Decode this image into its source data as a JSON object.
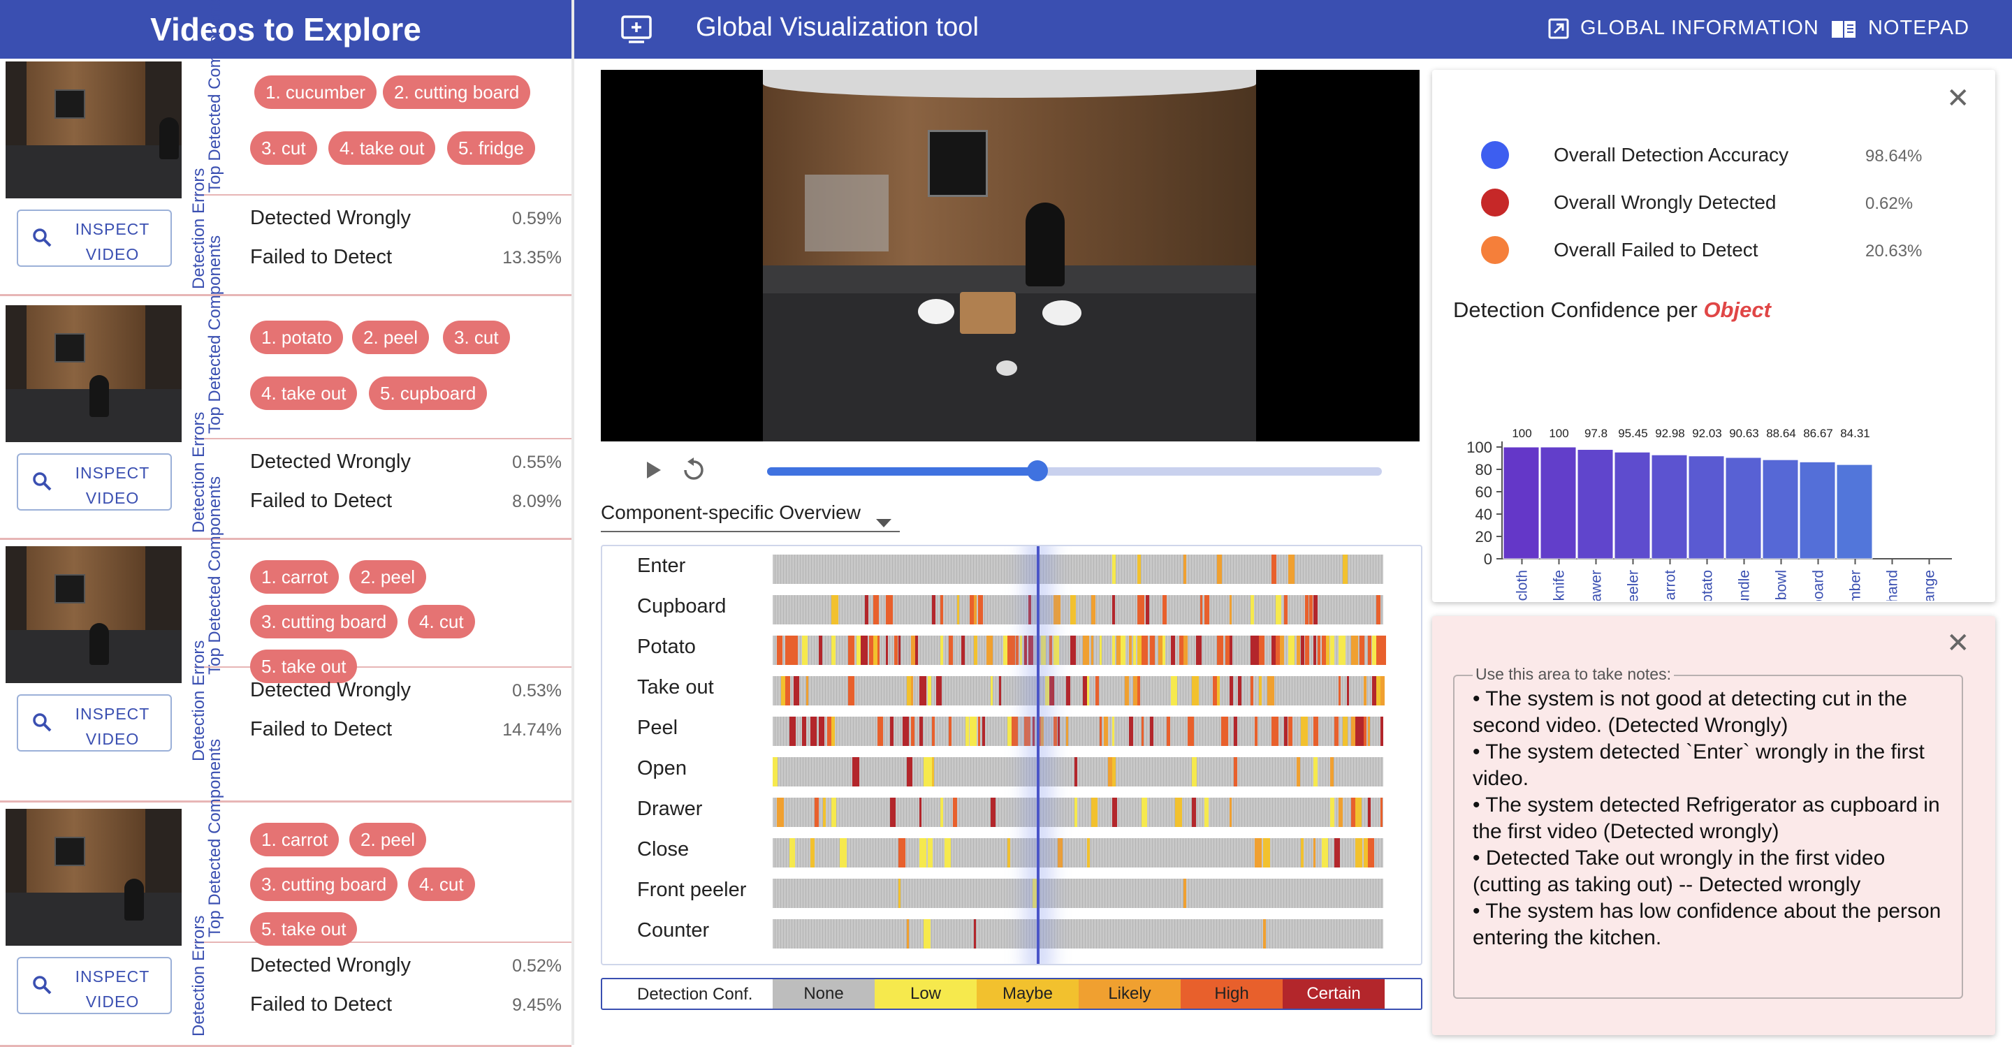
{
  "left_panel": {
    "title": "Videos to Explore",
    "components_label": "Top Detected Components",
    "errors_label": "Detection Errors",
    "inspect_label": "INSPECT VIDEO",
    "error_wrong_label": "Detected Wrongly",
    "error_failed_label": "Failed to Detect",
    "videos": [
      {
        "components": [
          "1. cucumber",
          "2. cutting board",
          "3. cut",
          "4. take out",
          "5. fridge"
        ],
        "wrong": "0.59%",
        "failed": "13.35%"
      },
      {
        "components": [
          "1. potato",
          "2. peel",
          "3. cut",
          "4. take out",
          "5. cupboard"
        ],
        "wrong": "0.55%",
        "failed": "8.09%"
      },
      {
        "components": [
          "1. carrot",
          "2. peel",
          "3. cutting board",
          "4. cut",
          "5. take out"
        ],
        "wrong": "0.53%",
        "failed": "14.74%"
      },
      {
        "components": [
          "1. carrot",
          "2. peel",
          "3. cutting board",
          "4. cut",
          "5. take out"
        ],
        "wrong": "0.52%",
        "failed": "9.45%"
      }
    ]
  },
  "header": {
    "title": "Global Visualization tool",
    "global_info_label": "GLOBAL INFORMATION",
    "notepad_label": "NOTEPAD",
    "color": "#3a4fb1"
  },
  "player": {
    "progress": 0.44,
    "view_select": "Component-specific Overview"
  },
  "heatmap": {
    "rows": [
      "Enter",
      "Cupboard",
      "Potato",
      "Take out",
      "Peel",
      "Open",
      "Drawer",
      "Close",
      "Front peeler",
      "Counter"
    ],
    "legend_title": "Detection Conf.",
    "legend": [
      {
        "label": "None",
        "color": "#bdbdbd"
      },
      {
        "label": "Low",
        "color": "#f6e94d"
      },
      {
        "label": "Maybe",
        "color": "#f2c12e"
      },
      {
        "label": "Likely",
        "color": "#f0a030"
      },
      {
        "label": "High",
        "color": "#e8602c"
      },
      {
        "label": "Certain",
        "color": "#b3262b"
      }
    ]
  },
  "metrics": [
    {
      "label": "Overall Detection Accuracy",
      "value": "98.64%",
      "color": "#3d5ef0"
    },
    {
      "label": "Overall Wrongly Detected",
      "value": "0.62%",
      "color": "#c62828"
    },
    {
      "label": "Overall Failed to Detect",
      "value": "20.63%",
      "color": "#f57f3a"
    }
  ],
  "chart_title_prefix": "Detection Confidence per ",
  "chart_title_emph": "Object",
  "chart_data": {
    "type": "bar",
    "categories": [
      "sponge cloth",
      "knife",
      "drawer",
      "front peeler",
      "carrot",
      "potato",
      "bundle",
      "bowl",
      "cutting board",
      "cucumber",
      "hand",
      "orange"
    ],
    "values": [
      100,
      100,
      97.8,
      95.45,
      92.98,
      92.03,
      90.63,
      88.64,
      86.67,
      84.31,
      null,
      null
    ],
    "value_labels": [
      "100",
      "100",
      "97.8",
      "95.45",
      "92.98",
      "92.03",
      "90.63",
      "88.64",
      "86.67",
      "84.31",
      "",
      ""
    ],
    "yticks": [
      "100",
      "80",
      "60",
      "40",
      "20",
      "0"
    ],
    "ylim": [
      0,
      100
    ]
  },
  "notes": {
    "legend": "Use this area to take notes:",
    "text": "• The system is not good at detecting cut in the second video. (Detected Wrongly)\n• The system detected `Enter` wrongly in the first video.\n• The system detected Refrigerator as cupboard in the first video (Detected wrongly)\n• Detected Take out wrongly in the first video (cutting as taking out) -- Detected wrongly\n•  The system has low confidence about the person entering the kitchen."
  }
}
